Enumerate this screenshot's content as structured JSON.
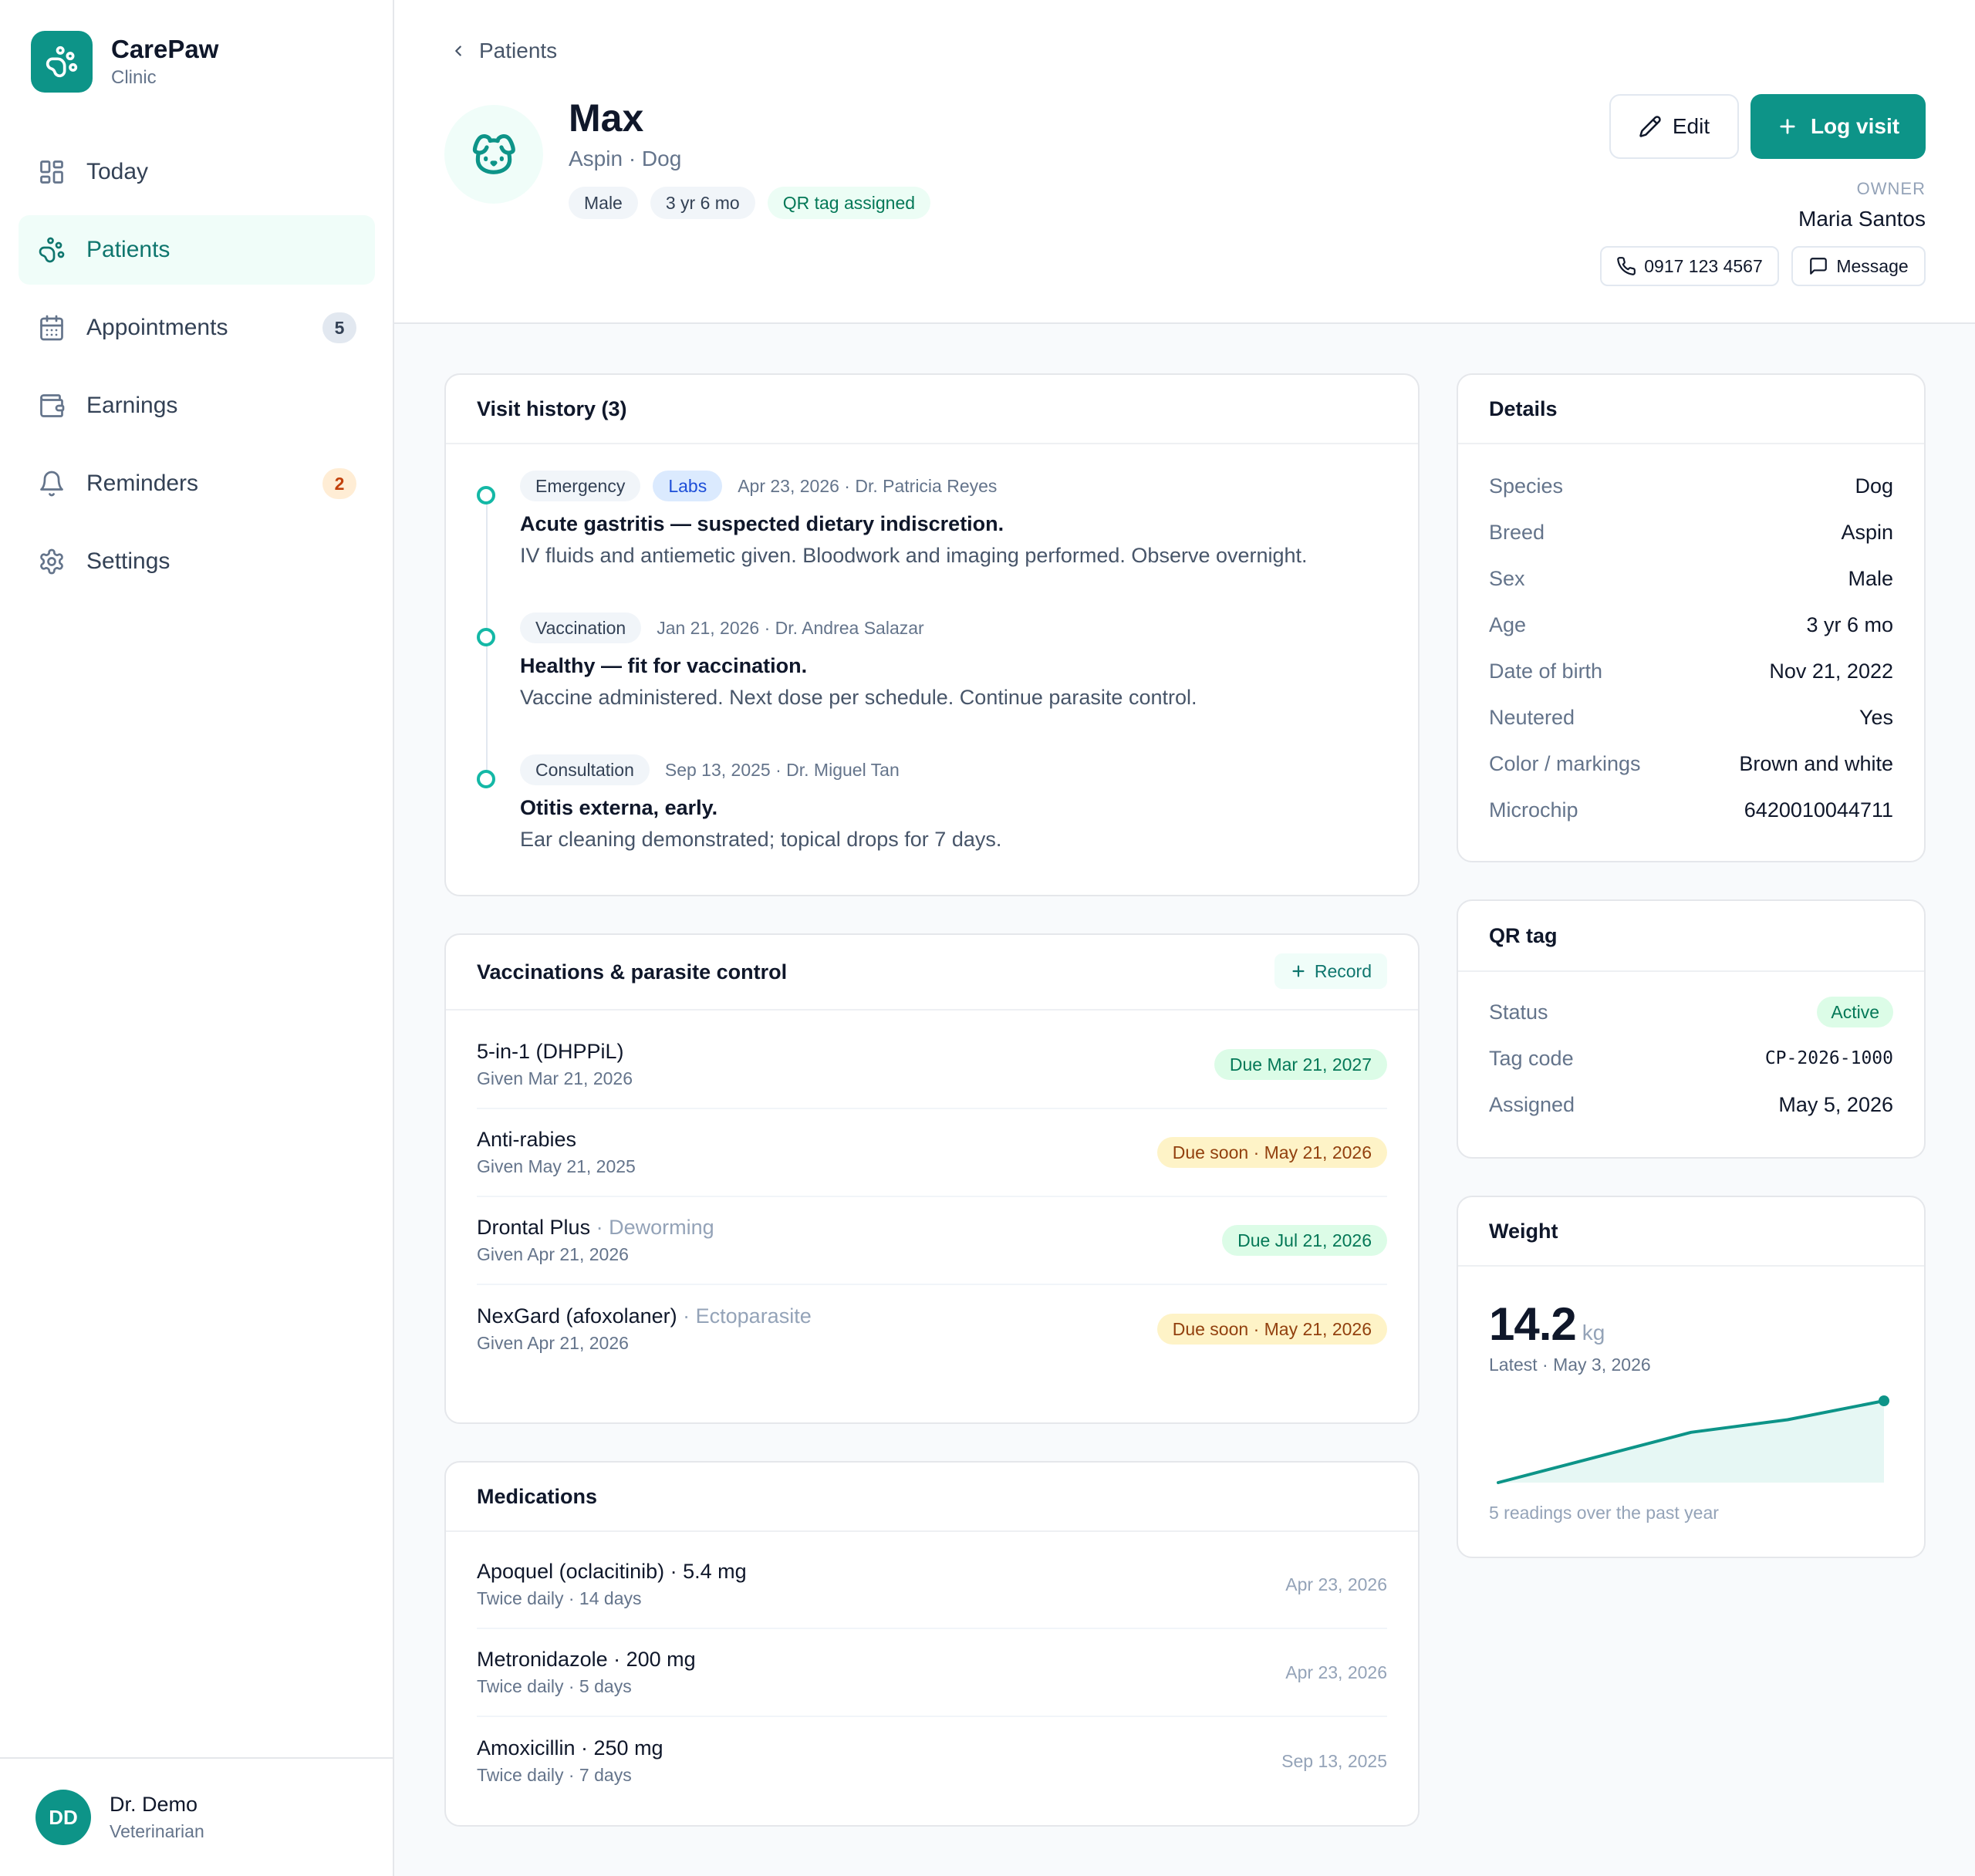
{
  "brand": {
    "name": "CarePaw",
    "sub": "Clinic"
  },
  "nav": [
    {
      "label": "Today",
      "icon": "grid-icon",
      "active": false
    },
    {
      "label": "Patients",
      "icon": "paw-icon",
      "active": true
    },
    {
      "label": "Appointments",
      "icon": "calendar-icon",
      "active": false,
      "badge": "5"
    },
    {
      "label": "Earnings",
      "icon": "wallet-icon",
      "active": false
    },
    {
      "label": "Reminders",
      "icon": "bell-icon",
      "active": false,
      "badge": "2"
    },
    {
      "label": "Settings",
      "icon": "gear-icon",
      "active": false
    }
  ],
  "user": {
    "initials": "DD",
    "name": "Dr. Demo",
    "role": "Veterinarian"
  },
  "header": {
    "breadcrumb": "Patients",
    "pet_name": "Max",
    "pet_breed": "Aspin · Dog",
    "chips": [
      "Male",
      "3 yr 6 mo",
      "QR tag assigned"
    ],
    "edit_label": "Edit",
    "log_label": "Log visit",
    "owner_label": "OWNER",
    "owner_name": "Maria Santos",
    "phone": "0917 123 4567",
    "message_label": "Message"
  },
  "visits": {
    "title": "Visit history (3)",
    "items": [
      {
        "tags": [
          "Emergency",
          "Labs"
        ],
        "meta": "Apr 23, 2026 · Dr. Patricia Reyes",
        "title": "Acute gastritis — suspected dietary indiscretion.",
        "desc": "IV fluids and antiemetic given. Bloodwork and imaging performed. Observe overnight."
      },
      {
        "tags": [
          "Vaccination"
        ],
        "meta": "Jan 21, 2026 · Dr. Andrea Salazar",
        "title": "Healthy — fit for vaccination.",
        "desc": "Vaccine administered. Next dose per schedule. Continue parasite control."
      },
      {
        "tags": [
          "Consultation"
        ],
        "meta": "Sep 13, 2025 · Dr. Miguel Tan",
        "title": "Otitis externa, early.",
        "desc": "Ear cleaning demonstrated; topical drops for 7 days."
      }
    ]
  },
  "vaccinations": {
    "title": "Vaccinations & parasite control",
    "record_label": "Record",
    "items": [
      {
        "name": "5-in-1 (DHPPiL)",
        "category": "",
        "given": "Given Mar 21, 2026",
        "due": "Due Mar 21, 2027",
        "status": "ok"
      },
      {
        "name": "Anti-rabies",
        "category": "",
        "given": "Given May 21, 2025",
        "due": "Due soon · May 21, 2026",
        "status": "soon"
      },
      {
        "name": "Drontal Plus",
        "category": "· Deworming",
        "given": "Given Apr 21, 2026",
        "due": "Due Jul 21, 2026",
        "status": "ok"
      },
      {
        "name": "NexGard (afoxolaner)",
        "category": "· Ectoparasite",
        "given": "Given Apr 21, 2026",
        "due": "Due soon · May 21, 2026",
        "status": "soon"
      }
    ]
  },
  "medications": {
    "title": "Medications",
    "items": [
      {
        "name": "Apoquel (oclacitinib) · 5.4 mg",
        "schedule": "Twice daily · 14 days",
        "date": "Apr 23, 2026"
      },
      {
        "name": "Metronidazole · 200 mg",
        "schedule": "Twice daily · 5 days",
        "date": "Apr 23, 2026"
      },
      {
        "name": "Amoxicillin · 250 mg",
        "schedule": "Twice daily · 7 days",
        "date": "Sep 13, 2025"
      }
    ]
  },
  "details": {
    "title": "Details",
    "rows": [
      {
        "key": "Species",
        "value": "Dog"
      },
      {
        "key": "Breed",
        "value": "Aspin"
      },
      {
        "key": "Sex",
        "value": "Male"
      },
      {
        "key": "Age",
        "value": "3 yr 6 mo"
      },
      {
        "key": "Date of birth",
        "value": "Nov 21, 2022"
      },
      {
        "key": "Neutered",
        "value": "Yes"
      },
      {
        "key": "Color / markings",
        "value": "Brown and white"
      },
      {
        "key": "Microchip",
        "value": "6420010044711"
      }
    ]
  },
  "qr": {
    "title": "QR tag",
    "status_label": "Status",
    "status_value": "Active",
    "code_label": "Tag code",
    "code_value": "CP-2026-1000",
    "assigned_label": "Assigned",
    "assigned_value": "May 5, 2026"
  },
  "weight": {
    "title": "Weight",
    "value": "14.2",
    "unit": "kg",
    "latest": "Latest · May 3, 2026",
    "footer": "5 readings over the past year",
    "accent": "#0d9488",
    "chart_data": {
      "type": "area",
      "values": [
        11.6,
        12.4,
        13.2,
        13.6,
        14.2
      ]
    }
  },
  "colors": {
    "accent": "#0d9488",
    "accent_light": "#f0fdf9"
  }
}
